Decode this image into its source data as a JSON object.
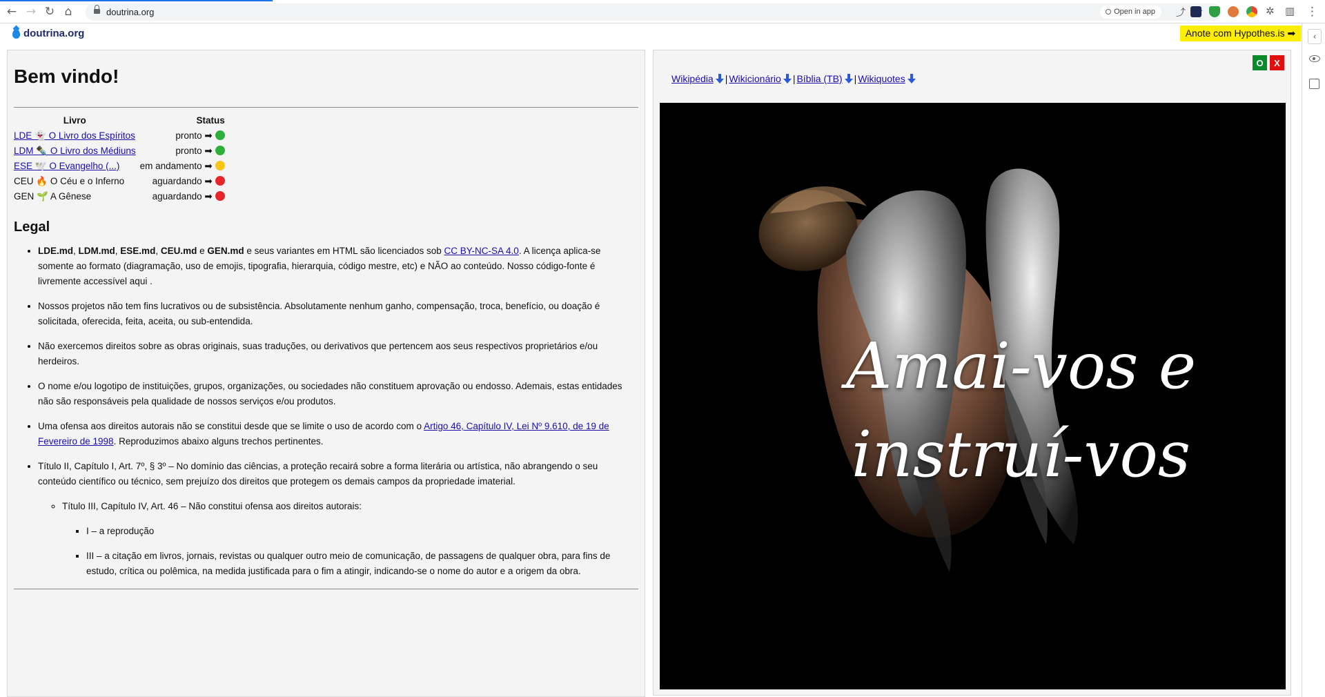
{
  "browser": {
    "url": "doutrina.org",
    "open_in_app": "Open in app"
  },
  "header": {
    "site_name": "doutrina.org",
    "hypothesis_button": "Anote com Hypothes.is ➡"
  },
  "left": {
    "title": "Bem vindo!",
    "table": {
      "headers": [
        "Livro",
        "Status"
      ],
      "rows": [
        {
          "book": "LDE 👻 O Livro dos Espíritos",
          "code": "LDE",
          "emoji": "👻",
          "name": "O Livro dos Espíritos",
          "link": true,
          "status": "pronto ➡",
          "status_color": "#2eae3a"
        },
        {
          "book": "LDM ✒️ O Livro dos Médiuns",
          "code": "LDM",
          "emoji": "✒️",
          "name": "O Livro dos Médiuns",
          "link": true,
          "status": "pronto ➡",
          "status_color": "#2eae3a"
        },
        {
          "book": "ESE 🕊️ O Evangelho (...)",
          "code": "ESE",
          "emoji": "🕊️",
          "name": "O Evangelho (...)",
          "link": true,
          "status": "em andamento ➡",
          "status_color": "#f5c518"
        },
        {
          "book": "CEU 🔥 O Céu e o Inferno",
          "code": "CEU",
          "emoji": "🔥",
          "name": "O Céu e o Inferno",
          "link": false,
          "status": "aguardando ➡",
          "status_color": "#e8262a"
        },
        {
          "book": "GEN 🌱 A Gênese",
          "code": "GEN",
          "emoji": "🌱",
          "name": "A Gênese",
          "link": false,
          "status": "aguardando ➡",
          "status_color": "#e8262a"
        }
      ]
    },
    "legal": {
      "heading": "Legal",
      "item1": {
        "b1": "LDE.md",
        "c1": ", ",
        "b2": "LDM.md",
        "c2": ", ",
        "b3": "ESE.md",
        "c3": ", ",
        "b4": "CEU.md",
        "c4": " e ",
        "b5": "GEN.md",
        "text_a": " e seus variantes em HTML são licenciados sob ",
        "link": "CC BY-NC-SA 4.0",
        "text_b": ". A licença aplica-se somente ao formato (diagramação, uso de emojis, tipografia, hierarquia, código mestre, etc) e NÃO ao conteúdo. Nosso código-fonte é livremente accessível aqui ."
      },
      "item2": "Nossos projetos não tem fins lucrativos ou de subsistência. Absolutamente nenhum ganho, compensação, troca, benefício, ou doação é solicitada, oferecida, feita, aceita, ou sub-entendida.",
      "item3": "Não exercemos direitos sobre as obras originais, suas traduções, ou derivativos que pertencem aos seus respectivos proprietários e/ou herdeiros.",
      "item4": "O nome e/ou logotipo de instituições, grupos, organizações, ou sociedades não constituem aprovação ou endosso. Ademais, estas entidades não são responsáveis pela qualidade de nossos serviços e/ou produtos.",
      "item5": {
        "text_a": "Uma ofensa aos direitos autorais não se constitui desde que se limite o uso de acordo com o ",
        "link": "Artigo 46, Capítulo IV, Lei Nº 9.610, de 19 de Fevereiro de 1998",
        "text_b": ". Reproduzimos abaixo alguns trechos pertinentes."
      },
      "item6": "Título II, Capítulo I, Art. 7º, § 3º – No domínio das ciências, a proteção recairá sobre a forma literária ou artística, não abrangendo o seu conteúdo científico ou técnico, sem prejuízo dos direitos que protegem os demais campos da propriedade imaterial.",
      "sub1": "Título III, Capítulo IV, Art. 46 – Não constitui ofensa aos direitos autorais:",
      "sub2a": "I – a reprodução",
      "sub2b": "III – a citação em livros, jornais, revistas ou qualquer outro meio de comunicação, de passagens de qualquer obra, para fins de estudo, crítica ou polêmica, na medida justificada para o fim a atingir, indicando-se o nome do autor e a origem da obra."
    }
  },
  "right": {
    "links": [
      "Wikipédia",
      "Wikicionário",
      "Bíblia (TB)",
      "Wikiquotes"
    ],
    "separator": "|",
    "btn_o": "O",
    "btn_x": "X",
    "motto_line1": "Amai-vos e",
    "motto_line2": "instruí-vos"
  }
}
